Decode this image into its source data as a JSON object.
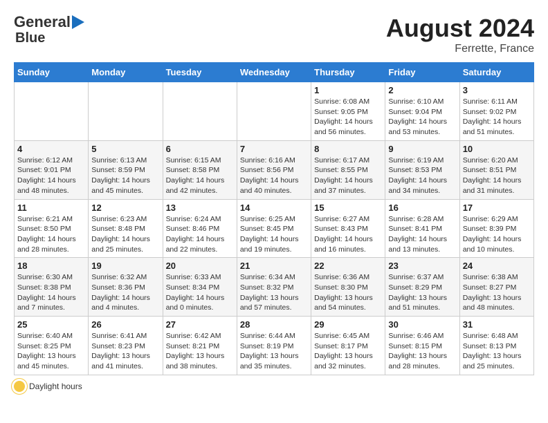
{
  "header": {
    "logo_line1": "General",
    "logo_line2": "Blue",
    "month_year": "August 2024",
    "location": "Ferrette, France"
  },
  "days_of_week": [
    "Sunday",
    "Monday",
    "Tuesday",
    "Wednesday",
    "Thursday",
    "Friday",
    "Saturday"
  ],
  "footer": {
    "note": "Daylight hours"
  },
  "weeks": [
    {
      "days": [
        {
          "num": "",
          "detail": ""
        },
        {
          "num": "",
          "detail": ""
        },
        {
          "num": "",
          "detail": ""
        },
        {
          "num": "",
          "detail": ""
        },
        {
          "num": "1",
          "detail": "Sunrise: 6:08 AM\nSunset: 9:05 PM\nDaylight: 14 hours\nand 56 minutes."
        },
        {
          "num": "2",
          "detail": "Sunrise: 6:10 AM\nSunset: 9:04 PM\nDaylight: 14 hours\nand 53 minutes."
        },
        {
          "num": "3",
          "detail": "Sunrise: 6:11 AM\nSunset: 9:02 PM\nDaylight: 14 hours\nand 51 minutes."
        }
      ]
    },
    {
      "days": [
        {
          "num": "4",
          "detail": "Sunrise: 6:12 AM\nSunset: 9:01 PM\nDaylight: 14 hours\nand 48 minutes."
        },
        {
          "num": "5",
          "detail": "Sunrise: 6:13 AM\nSunset: 8:59 PM\nDaylight: 14 hours\nand 45 minutes."
        },
        {
          "num": "6",
          "detail": "Sunrise: 6:15 AM\nSunset: 8:58 PM\nDaylight: 14 hours\nand 42 minutes."
        },
        {
          "num": "7",
          "detail": "Sunrise: 6:16 AM\nSunset: 8:56 PM\nDaylight: 14 hours\nand 40 minutes."
        },
        {
          "num": "8",
          "detail": "Sunrise: 6:17 AM\nSunset: 8:55 PM\nDaylight: 14 hours\nand 37 minutes."
        },
        {
          "num": "9",
          "detail": "Sunrise: 6:19 AM\nSunset: 8:53 PM\nDaylight: 14 hours\nand 34 minutes."
        },
        {
          "num": "10",
          "detail": "Sunrise: 6:20 AM\nSunset: 8:51 PM\nDaylight: 14 hours\nand 31 minutes."
        }
      ]
    },
    {
      "days": [
        {
          "num": "11",
          "detail": "Sunrise: 6:21 AM\nSunset: 8:50 PM\nDaylight: 14 hours\nand 28 minutes."
        },
        {
          "num": "12",
          "detail": "Sunrise: 6:23 AM\nSunset: 8:48 PM\nDaylight: 14 hours\nand 25 minutes."
        },
        {
          "num": "13",
          "detail": "Sunrise: 6:24 AM\nSunset: 8:46 PM\nDaylight: 14 hours\nand 22 minutes."
        },
        {
          "num": "14",
          "detail": "Sunrise: 6:25 AM\nSunset: 8:45 PM\nDaylight: 14 hours\nand 19 minutes."
        },
        {
          "num": "15",
          "detail": "Sunrise: 6:27 AM\nSunset: 8:43 PM\nDaylight: 14 hours\nand 16 minutes."
        },
        {
          "num": "16",
          "detail": "Sunrise: 6:28 AM\nSunset: 8:41 PM\nDaylight: 14 hours\nand 13 minutes."
        },
        {
          "num": "17",
          "detail": "Sunrise: 6:29 AM\nSunset: 8:39 PM\nDaylight: 14 hours\nand 10 minutes."
        }
      ]
    },
    {
      "days": [
        {
          "num": "18",
          "detail": "Sunrise: 6:30 AM\nSunset: 8:38 PM\nDaylight: 14 hours\nand 7 minutes."
        },
        {
          "num": "19",
          "detail": "Sunrise: 6:32 AM\nSunset: 8:36 PM\nDaylight: 14 hours\nand 4 minutes."
        },
        {
          "num": "20",
          "detail": "Sunrise: 6:33 AM\nSunset: 8:34 PM\nDaylight: 14 hours\nand 0 minutes."
        },
        {
          "num": "21",
          "detail": "Sunrise: 6:34 AM\nSunset: 8:32 PM\nDaylight: 13 hours\nand 57 minutes."
        },
        {
          "num": "22",
          "detail": "Sunrise: 6:36 AM\nSunset: 8:30 PM\nDaylight: 13 hours\nand 54 minutes."
        },
        {
          "num": "23",
          "detail": "Sunrise: 6:37 AM\nSunset: 8:29 PM\nDaylight: 13 hours\nand 51 minutes."
        },
        {
          "num": "24",
          "detail": "Sunrise: 6:38 AM\nSunset: 8:27 PM\nDaylight: 13 hours\nand 48 minutes."
        }
      ]
    },
    {
      "days": [
        {
          "num": "25",
          "detail": "Sunrise: 6:40 AM\nSunset: 8:25 PM\nDaylight: 13 hours\nand 45 minutes."
        },
        {
          "num": "26",
          "detail": "Sunrise: 6:41 AM\nSunset: 8:23 PM\nDaylight: 13 hours\nand 41 minutes."
        },
        {
          "num": "27",
          "detail": "Sunrise: 6:42 AM\nSunset: 8:21 PM\nDaylight: 13 hours\nand 38 minutes."
        },
        {
          "num": "28",
          "detail": "Sunrise: 6:44 AM\nSunset: 8:19 PM\nDaylight: 13 hours\nand 35 minutes."
        },
        {
          "num": "29",
          "detail": "Sunrise: 6:45 AM\nSunset: 8:17 PM\nDaylight: 13 hours\nand 32 minutes."
        },
        {
          "num": "30",
          "detail": "Sunrise: 6:46 AM\nSunset: 8:15 PM\nDaylight: 13 hours\nand 28 minutes."
        },
        {
          "num": "31",
          "detail": "Sunrise: 6:48 AM\nSunset: 8:13 PM\nDaylight: 13 hours\nand 25 minutes."
        }
      ]
    }
  ]
}
